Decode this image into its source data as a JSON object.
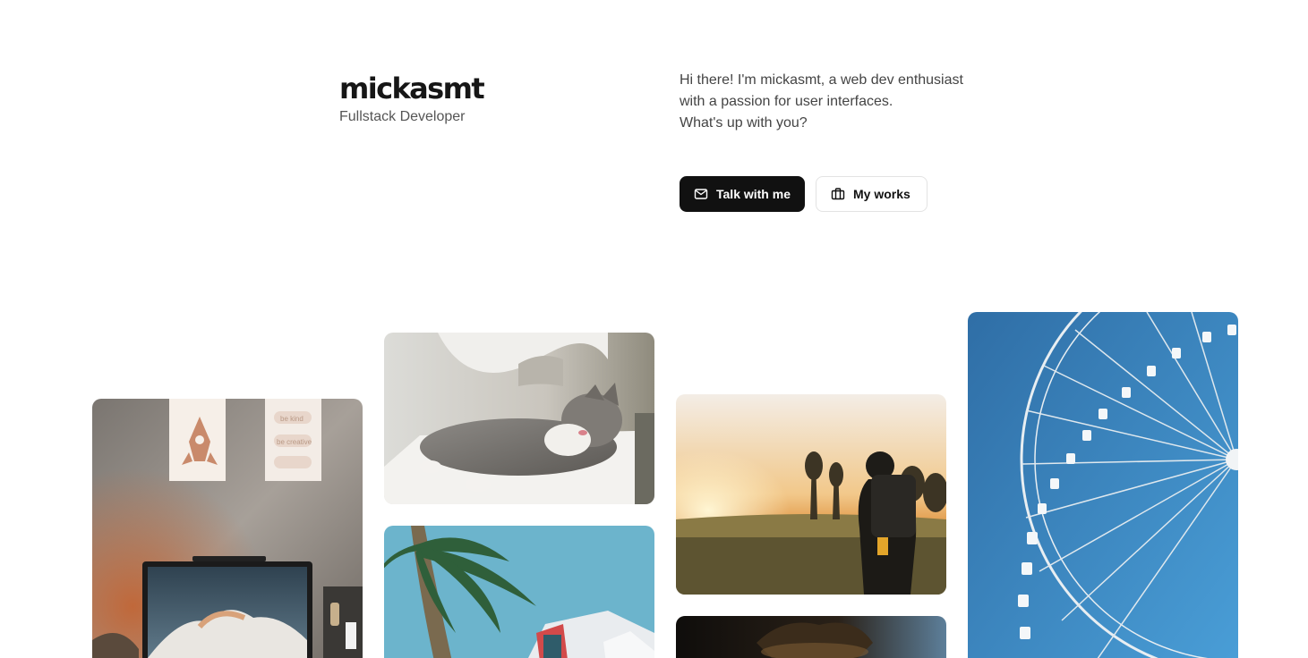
{
  "profile": {
    "name": "mickasmt",
    "role": "Fullstack Developer",
    "bio_lines": [
      "Hi there! I'm mickasmt, a web dev enthusiast",
      "with a passion for user interfaces.",
      "What's up with you?"
    ]
  },
  "actions": {
    "contact_label": "Talk with me",
    "contact_icon": "mail-icon",
    "works_label": "My works",
    "works_icon": "briefcase-icon"
  },
  "gallery": {
    "photos": [
      "workspace-desk-photo",
      "sleeping-cat-photo",
      "palm-tree-building-photo",
      "hiker-sunset-photo",
      "dark-lamp-photo",
      "ferris-wheel-photo"
    ],
    "poster_words": [
      "be kind",
      "be creative"
    ]
  }
}
